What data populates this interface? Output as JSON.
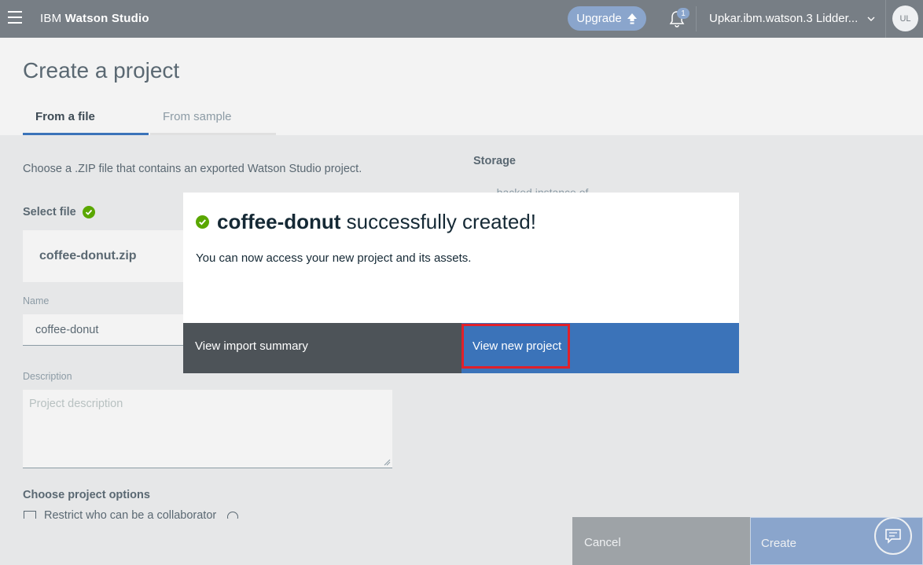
{
  "topbar": {
    "brand_prefix": "IBM",
    "brand_name": "Watson Studio",
    "upgrade_label": "Upgrade",
    "notification_count": "1",
    "account_name": "Upkar.ibm.watson.3 Lidder...",
    "avatar_initials": "UL"
  },
  "header": {
    "title": "Create a project",
    "tabs": [
      {
        "label": "From a file",
        "active": true
      },
      {
        "label": "From sample",
        "active": false
      }
    ]
  },
  "form": {
    "choose_text": "Choose a .ZIP file that contains an exported Watson Studio project.",
    "select_file_label": "Select file",
    "file_name": "coffee-donut.zip",
    "name_label": "Name",
    "name_value": "coffee-donut",
    "description_label": "Description",
    "description_placeholder": "Project description",
    "options_label": "Choose project options",
    "restrict_label": "Restrict who can be a collaborator"
  },
  "storage": {
    "title": "Storage",
    "text": "...backed instance of..."
  },
  "footer": {
    "cancel_label": "Cancel",
    "create_label": "Create"
  },
  "modal": {
    "project_name": "coffee-donut",
    "title_suffix": "successfully created!",
    "body": "You can now access your new project and its assets.",
    "summary_label": "View import summary",
    "view_project_label": "View new project"
  },
  "colors": {
    "topbar": "#777e85",
    "primary": "#3b73b9",
    "success": "#5aa700",
    "highlight": "#e0202a"
  }
}
